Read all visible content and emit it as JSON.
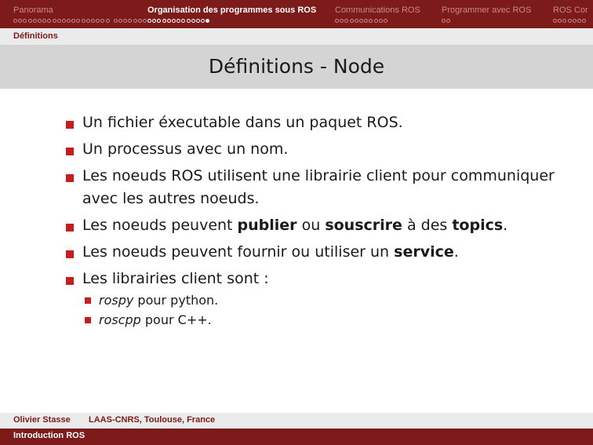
{
  "colors": {
    "header_bg": "#7d1a1a",
    "bullet": "#c41e1e",
    "title_bar_bg": "#d4d4d4",
    "subbar_bg": "#ebebeb"
  },
  "nav": {
    "sections": [
      {
        "name": "Panorama",
        "active": false,
        "groups": [
          20,
          12
        ],
        "filled_index": -1
      },
      {
        "name": "Organisation des programmes sous ROS",
        "active": true,
        "groups": [
          13
        ],
        "filled_index": 12
      },
      {
        "name": "Communications ROS",
        "active": false,
        "groups": [
          11
        ],
        "filled_index": -1
      },
      {
        "name": "Programmer avec ROS",
        "active": false,
        "groups": [
          2
        ],
        "filled_index": -1
      },
      {
        "name": "ROS Cor",
        "active": false,
        "groups": [
          7
        ],
        "filled_index": -1
      }
    ]
  },
  "subtitle": "Définitions",
  "slide": {
    "title": "Définitions - Node",
    "items": [
      {
        "parts": [
          {
            "text": "Un fichier éxecutable dans un paquet ROS.",
            "bold": false
          }
        ]
      },
      {
        "parts": [
          {
            "text": "Un processus avec un nom.",
            "bold": false
          }
        ]
      },
      {
        "parts": [
          {
            "text": "Les noeuds ROS utilisent une librairie client pour communiquer avec les autres noeuds.",
            "bold": false
          }
        ]
      },
      {
        "parts": [
          {
            "text": "Les noeuds peuvent ",
            "bold": false
          },
          {
            "text": "publier",
            "bold": true
          },
          {
            "text": " ou ",
            "bold": false
          },
          {
            "text": "souscrire",
            "bold": true
          },
          {
            "text": " à des ",
            "bold": false
          },
          {
            "text": "topics",
            "bold": true
          },
          {
            "text": ".",
            "bold": false
          }
        ]
      },
      {
        "parts": [
          {
            "text": "Les noeuds peuvent fournir ou utiliser un ",
            "bold": false
          },
          {
            "text": "service",
            "bold": true
          },
          {
            "text": ".",
            "bold": false
          }
        ]
      },
      {
        "parts": [
          {
            "text": "Les librairies client sont :",
            "bold": false
          }
        ],
        "subitems": [
          {
            "name": "rospy",
            "rest": " pour python."
          },
          {
            "name": "roscpp",
            "rest": " pour C++."
          }
        ]
      }
    ]
  },
  "footer": {
    "author": "Olivier Stasse",
    "affiliation": "LAAS-CNRS, Toulouse, France",
    "talk_title": "Introduction ROS"
  }
}
